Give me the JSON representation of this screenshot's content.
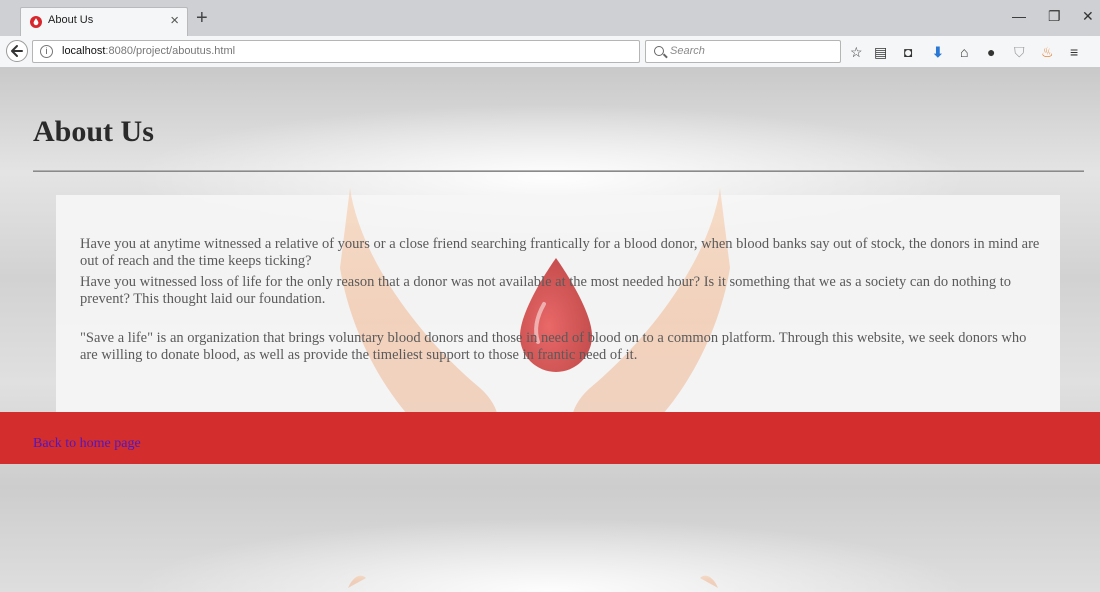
{
  "browser": {
    "tab_title": "About Us",
    "url_host": "localhost",
    "url_rest": ":8080/project/aboutus.html",
    "search_placeholder": "Search"
  },
  "page": {
    "heading": "About Us",
    "para1": "Have you at anytime witnessed a relative of yours or a close friend searching frantically for a blood donor, when blood banks say out of stock, the donors in mind are out of reach and the time keeps ticking?",
    "para2": "Have you witnessed loss of life for the only reason that a donor was not available at the most needed hour? Is it something that we as a society can do nothing to prevent? This thought laid our foundation.",
    "para3": "\"Save a life\" is an organization that brings voluntary blood donors and those in need of blood on to a common platform. Through this website, we seek donors who are willing to donate blood, as well as provide the timeliest support to those in frantic need of it.",
    "home_link": "Back to home page"
  },
  "colors": {
    "band": "#d32d2d",
    "link": "#5018c0"
  }
}
